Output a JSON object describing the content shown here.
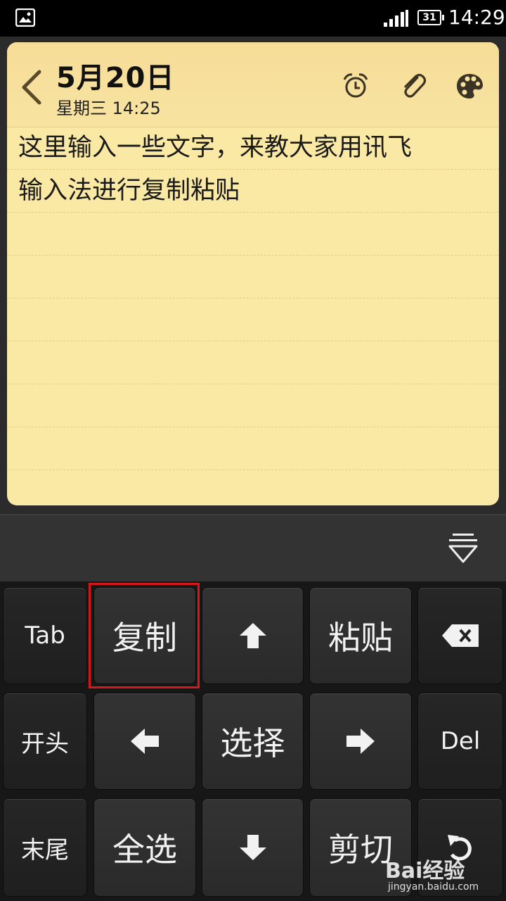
{
  "status_bar": {
    "battery": "31",
    "time": "14:29"
  },
  "note": {
    "title": "5月20日",
    "subtitle": "星期三 14:25",
    "lines": [
      "这里输入一些文字，来教大家用讯飞",
      "输入法进行复制粘贴"
    ],
    "background_color": "#fae8a5"
  },
  "keyboard": {
    "keys": {
      "tab": "Tab",
      "copy": "复制",
      "paste": "粘贴",
      "home": "开头",
      "select": "选择",
      "del": "Del",
      "end": "末尾",
      "select_all": "全选",
      "cut": "剪切"
    },
    "highlight_color": "#d8171d"
  },
  "watermark": {
    "brand": "Bai经验",
    "url": "jingyan.baidu.com"
  }
}
